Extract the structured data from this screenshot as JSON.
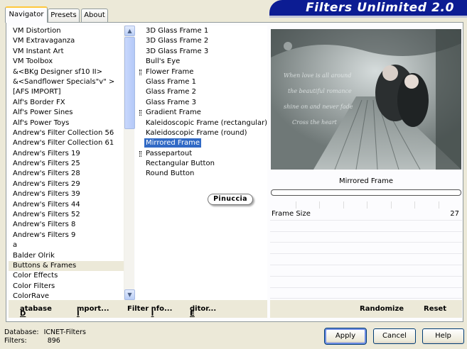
{
  "app_title": "Filters Unlimited 2.0",
  "tabs": [
    "Navigator",
    "Presets",
    "About"
  ],
  "categories": [
    "VM Distortion",
    "VM Extravaganza",
    "VM Instant Art",
    "VM Toolbox",
    "&<BKg Designer sf10 II>",
    "&<Sandflower Specials\"v\" >",
    "[AFS IMPORT]",
    "Alf's Border FX",
    "Alf's Power Sines",
    "Alf's Power Toys",
    "Andrew's Filter Collection 56",
    "Andrew's Filter Collection 61",
    "Andrew's Filters 19",
    "Andrew's Filters 25",
    "Andrew's Filters 28",
    "Andrew's Filters 29",
    "Andrew's Filters 39",
    "Andrew's Filters 44",
    "Andrew's Filters 52",
    "Andrew's Filters 8",
    "Andrew's Filters 9",
    "a",
    "Balder Olrik",
    "Buttons & Frames",
    "Color Effects",
    "Color Filters",
    "ColorRave"
  ],
  "filters": [
    "3D Glass Frame 1",
    "3D Glass Frame 2",
    "3D Glass Frame 3",
    "Bull's Eye",
    "Flower Frame",
    "Glass Frame 1",
    "Glass Frame 2",
    "Glass Frame 3",
    "Gradient Frame",
    "Kaleidoscopic Frame (rectangular)",
    "Kaleidoscopic Frame (round)",
    "Mirrored Frame",
    "Passepartout",
    "Rectangular Button",
    "Round Button"
  ],
  "watermark": "Pinuccia",
  "selected_filter_name": "Mirrored Frame",
  "progress_fraction": 0,
  "control": {
    "label": "Frame Size",
    "value": "27"
  },
  "nav_buttons": {
    "database": "Database",
    "import": "Import...",
    "filter_info": "Filter Info...",
    "editor": "Editor..."
  },
  "right_buttons": {
    "randomize": "Randomize",
    "reset": "Reset"
  },
  "status": {
    "database_label": "Database:",
    "database_value": "ICNET-Filters",
    "filters_label": "Filters:",
    "filters_value": "896"
  },
  "dialog_buttons": {
    "apply": "Apply",
    "cancel": "Cancel",
    "help": "Help"
  },
  "colors": {
    "title_bg": "#0c1c93",
    "selection": "#316ac5",
    "dialog_bg": "#ece9d8"
  }
}
